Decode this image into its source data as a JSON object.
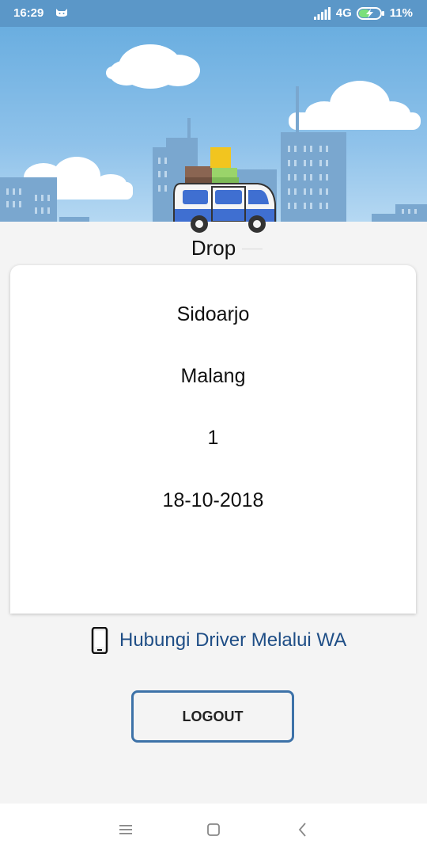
{
  "status_bar": {
    "time": "16:29",
    "network": "4G",
    "battery": "11%",
    "icons": [
      "cat-notification-icon",
      "signal-icon",
      "battery-charging-icon"
    ]
  },
  "header": {
    "title": "Drop",
    "illustration": "van-with-luggage-city-skyline"
  },
  "trip": {
    "origin": "Sidoarjo",
    "destination": "Malang",
    "passengers": "1",
    "date": "18-10-2018"
  },
  "contact": {
    "label": "Hubungi Driver Melalui WA",
    "icon": "phone-icon"
  },
  "logout": {
    "label": "LOGOUT"
  },
  "navigation": {
    "icons": [
      "menu-icon",
      "home-icon",
      "back-icon"
    ]
  },
  "colors": {
    "status_bar": "#5b97c8",
    "sky": "#8fc2ea",
    "van_blue": "#3f6fd1",
    "link": "#1f4e86",
    "button_border": "#3d72a8"
  }
}
